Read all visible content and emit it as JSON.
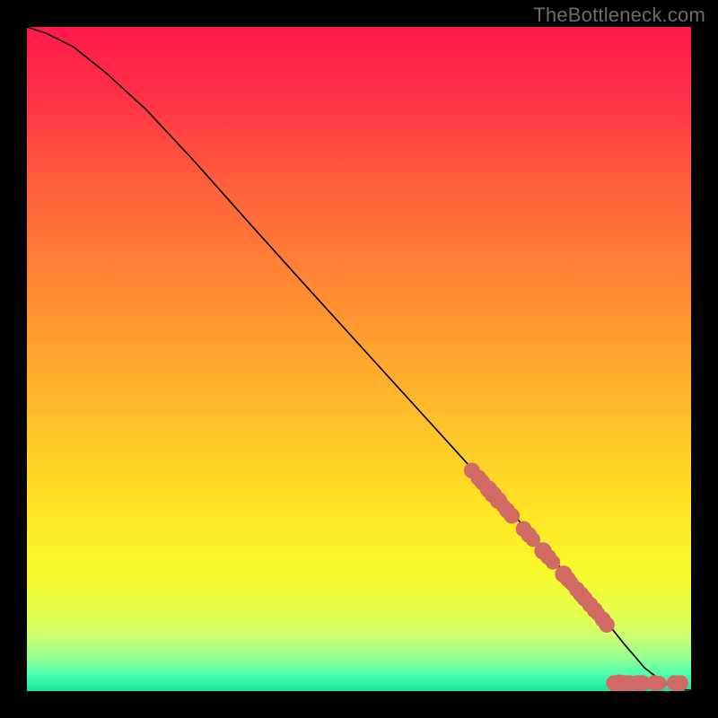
{
  "watermark": "TheBottleneck.com",
  "colors": {
    "background": "#000000",
    "watermark_text": "#6b6b6b",
    "curve_stroke": "#000000",
    "point_fill": "#d26a64",
    "gradient_stops": [
      {
        "offset": 0.0,
        "color": "#ff1a4b"
      },
      {
        "offset": 0.1,
        "color": "#ff2f47"
      },
      {
        "offset": 0.22,
        "color": "#ff5a3c"
      },
      {
        "offset": 0.35,
        "color": "#ff7e35"
      },
      {
        "offset": 0.48,
        "color": "#ffa12f"
      },
      {
        "offset": 0.6,
        "color": "#ffc229"
      },
      {
        "offset": 0.72,
        "color": "#ffe324"
      },
      {
        "offset": 0.82,
        "color": "#f8fa2a"
      },
      {
        "offset": 0.88,
        "color": "#e6ff4a"
      },
      {
        "offset": 0.92,
        "color": "#c8ff70"
      },
      {
        "offset": 0.95,
        "color": "#94ff90"
      },
      {
        "offset": 0.975,
        "color": "#4affb0"
      },
      {
        "offset": 1.0,
        "color": "#17e59b"
      }
    ]
  },
  "chart_data": {
    "type": "line",
    "title": "",
    "xlabel": "",
    "ylabel": "",
    "xlim": [
      0,
      100
    ],
    "ylim": [
      0,
      100
    ],
    "series": [
      {
        "name": "bottleneck-curve",
        "x": [
          0,
          3,
          7,
          12,
          18,
          25,
          33,
          42,
          52,
          62,
          72,
          80,
          86,
          90,
          93,
          96,
          98,
          100
        ],
        "y": [
          100,
          99,
          97,
          93,
          87.5,
          80,
          71,
          61,
          50,
          39,
          28,
          19,
          12,
          7,
          3.5,
          1.2,
          0.3,
          0.1
        ]
      }
    ],
    "points": [
      {
        "name": "data-point",
        "x": 67,
        "y": 33.2,
        "r": 1.2
      },
      {
        "name": "data-point",
        "x": 68,
        "y": 32.1,
        "r": 1.2
      },
      {
        "name": "data-point",
        "x": 68.6,
        "y": 31.4,
        "r": 1.2
      },
      {
        "name": "data-point",
        "x": 69.5,
        "y": 30.4,
        "r": 1.3
      },
      {
        "name": "data-point",
        "x": 70.2,
        "y": 29.6,
        "r": 1.3
      },
      {
        "name": "data-point",
        "x": 71,
        "y": 28.7,
        "r": 1.3
      },
      {
        "name": "data-point",
        "x": 71.7,
        "y": 27.9,
        "r": 1.1
      },
      {
        "name": "data-point",
        "x": 72.3,
        "y": 27.2,
        "r": 1.2
      },
      {
        "name": "data-point",
        "x": 73,
        "y": 26.4,
        "r": 1.2
      },
      {
        "name": "data-point",
        "x": 74.8,
        "y": 24.4,
        "r": 1.2
      },
      {
        "name": "data-point",
        "x": 75.6,
        "y": 23.5,
        "r": 1.2
      },
      {
        "name": "data-point",
        "x": 76.2,
        "y": 22.8,
        "r": 1.1
      },
      {
        "name": "data-point",
        "x": 77.7,
        "y": 21.1,
        "r": 1.3
      },
      {
        "name": "data-point",
        "x": 78.5,
        "y": 20.2,
        "r": 1.2
      },
      {
        "name": "data-point",
        "x": 79.2,
        "y": 19.4,
        "r": 1.1
      },
      {
        "name": "data-point",
        "x": 80.8,
        "y": 17.6,
        "r": 1.3
      },
      {
        "name": "data-point",
        "x": 81.5,
        "y": 16.8,
        "r": 1.2
      },
      {
        "name": "data-point",
        "x": 82,
        "y": 16.2,
        "r": 1.1
      },
      {
        "name": "data-point",
        "x": 82.8,
        "y": 15.3,
        "r": 1.2
      },
      {
        "name": "data-point",
        "x": 83.4,
        "y": 14.6,
        "r": 1.2
      },
      {
        "name": "data-point",
        "x": 84,
        "y": 13.9,
        "r": 1.2
      },
      {
        "name": "data-point",
        "x": 84.8,
        "y": 13,
        "r": 1.2
      },
      {
        "name": "data-point",
        "x": 85.5,
        "y": 12.2,
        "r": 1.2
      },
      {
        "name": "data-point",
        "x": 86,
        "y": 11.6,
        "r": 1.1
      },
      {
        "name": "data-point",
        "x": 86.7,
        "y": 10.8,
        "r": 1.2
      },
      {
        "name": "data-point",
        "x": 87.3,
        "y": 10.0,
        "r": 1.2
      },
      {
        "name": "data-point",
        "x": 88.4,
        "y": 1.2,
        "r": 1.2
      },
      {
        "name": "data-point",
        "x": 89.2,
        "y": 1.2,
        "r": 1.3
      },
      {
        "name": "data-point",
        "x": 90.0,
        "y": 1.2,
        "r": 1.2
      },
      {
        "name": "data-point",
        "x": 90.7,
        "y": 1.2,
        "r": 1.2
      },
      {
        "name": "data-point",
        "x": 91.3,
        "y": 1.2,
        "r": 1.1
      },
      {
        "name": "data-point",
        "x": 92,
        "y": 1.2,
        "r": 1.2
      },
      {
        "name": "data-point",
        "x": 92.7,
        "y": 1.2,
        "r": 1.2
      },
      {
        "name": "data-point",
        "x": 94.5,
        "y": 1.2,
        "r": 1.2
      },
      {
        "name": "data-point",
        "x": 95.2,
        "y": 1.2,
        "r": 1.1
      },
      {
        "name": "data-point",
        "x": 97.5,
        "y": 1.2,
        "r": 1.2
      },
      {
        "name": "data-point",
        "x": 98.4,
        "y": 1.2,
        "r": 1.2
      }
    ]
  }
}
